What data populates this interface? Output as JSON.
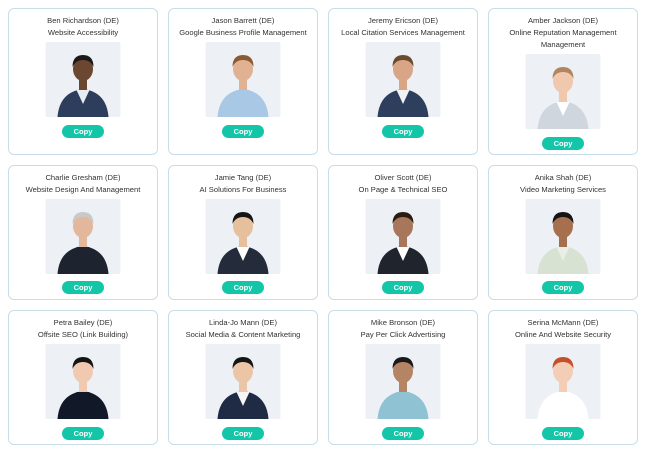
{
  "cards": [
    {
      "name": "Ben Richardson (DE)",
      "role": "Website Accessibility",
      "copy_label": "Copy",
      "skin": "#6b4630",
      "hair": "#1a1a1a",
      "outfit": "#2d3d5c",
      "shirt": "#e8edf2"
    },
    {
      "name": "Jason Barrett (DE)",
      "role": "Google Business Profile Management",
      "copy_label": "Copy",
      "skin": "#e0b293",
      "hair": "#8a5a33",
      "outfit": "#a9c8e6",
      "shirt": "#a9c8e6"
    },
    {
      "name": "Jeremy Ericson (DE)",
      "role": "Local Citation Services Management",
      "copy_label": "Copy",
      "skin": "#d8a586",
      "hair": "#6b4a2e",
      "outfit": "#2e3f5e",
      "shirt": "#f2f2f2"
    },
    {
      "name": "Amber Jackson (DE)",
      "role": "Online Reputation Management Management",
      "copy_label": "Copy",
      "skin": "#f0c8ae",
      "hair": "#b08660",
      "outfit": "#cfd6de",
      "shirt": "#ffffff"
    },
    {
      "name": "Charlie Gresham (DE)",
      "role": "Website Design And Management",
      "copy_label": "Copy",
      "skin": "#e2b79c",
      "hair": "#c9c9c9",
      "outfit": "#1d2430",
      "shirt": "#1d2430"
    },
    {
      "name": "Jamie Tang (DE)",
      "role": "AI Solutions For Business",
      "copy_label": "Copy",
      "skin": "#e6bf9d",
      "hair": "#151515",
      "outfit": "#242b3a",
      "shirt": "#ffffff"
    },
    {
      "name": "Oliver Scott (DE)",
      "role": "On Page & Technical SEO",
      "copy_label": "Copy",
      "skin": "#a8765a",
      "hair": "#2b1c12",
      "outfit": "#20242c",
      "shirt": "#ffffff"
    },
    {
      "name": "Anika Shah (DE)",
      "role": "Video Marketing Services",
      "copy_label": "Copy",
      "skin": "#a6704f",
      "hair": "#141414",
      "outfit": "#d7e2d3",
      "shirt": "#e9efe6"
    },
    {
      "name": "Petra Bailey (DE)",
      "role": "Offsite SEO (Link Building)",
      "copy_label": "Copy",
      "skin": "#f1c9b0",
      "hair": "#141414",
      "outfit": "#111827",
      "shirt": "#111827"
    },
    {
      "name": "Linda-Jo Mann (DE)",
      "role": "Social Media & Content Marketing",
      "copy_label": "Copy",
      "skin": "#ecc4a6",
      "hair": "#151515",
      "outfit": "#1f2a44",
      "shirt": "#f5f5f5"
    },
    {
      "name": "Mike Bronson (DE)",
      "role": "Pay Per Click Advertising",
      "copy_label": "Copy",
      "skin": "#b58464",
      "hair": "#1a1a1a",
      "outfit": "#8fc2d3",
      "shirt": "#8fc2d3"
    },
    {
      "name": "Serina McMann (DE)",
      "role": "Online And Website Security",
      "copy_label": "Copy",
      "skin": "#f3cdb6",
      "hair": "#c2512b",
      "outfit": "#ffffff",
      "shirt": "#ffffff"
    }
  ]
}
